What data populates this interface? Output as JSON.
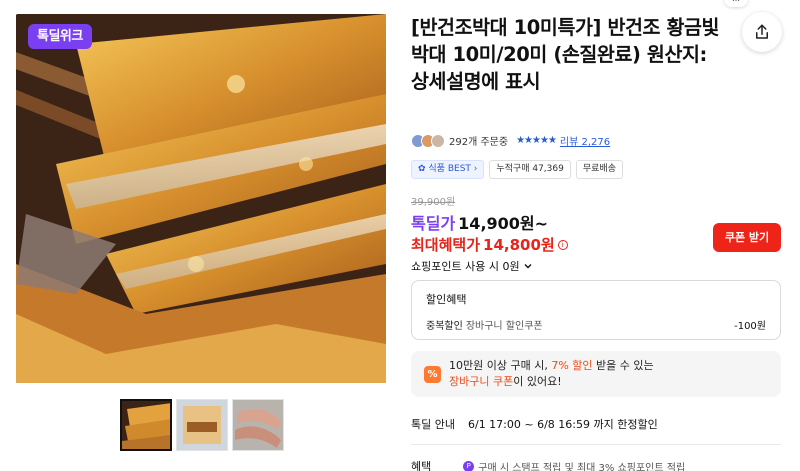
{
  "main_image": {
    "badge": "톡딜위크",
    "alt": "main-product-photo"
  },
  "thumbnails": [
    {
      "alt": "thumb-1"
    },
    {
      "alt": "thumb-2"
    },
    {
      "alt": "thumb-3"
    }
  ],
  "product": {
    "title": "[반건조박대 10미특가] 반건조 황금빛 박대 10미/20미 (손질완료) 원산지: 상세설명에 표시"
  },
  "share": {
    "tooltip": "…"
  },
  "stats": {
    "orders": "292개 주문중",
    "stars": "★★★★★",
    "review": "리뷰 2,276"
  },
  "tags": [
    "식품 BEST",
    "누적구매 47,369",
    "무료배송"
  ],
  "price": {
    "original": "39,900원",
    "deal_label": "톡딜가",
    "deal_price": "14,900원~",
    "max_label": "최대혜택가",
    "max_price": "14,800원",
    "coupon_button": "쿠폰 받기",
    "point_text": "쇼핑포인트 사용 시 0원"
  },
  "benefit": {
    "title": "할인혜택",
    "row_key": "중복할인",
    "row_desc": "장바구니 할인쿠폰",
    "row_amount": "-100원"
  },
  "promo": {
    "icon": "%",
    "line1_a": "10만원 이상 구매 시, ",
    "line1_accent": "7% 할인",
    "line1_b": " 받을 수 있는",
    "line2_accent": "장바구니 쿠폰",
    "line2_b": "이 있어요!"
  },
  "notice": {
    "label": "톡딜 안내",
    "text": "6/1 17:00 ~ 6/8 16:59 까지 한정할인"
  },
  "perks": {
    "label": "혜택",
    "text": "구매 시 스탬프 적립 및 최대 3% 쇼핑포인트 적립"
  },
  "colors": {
    "deal_purple": "#7b3ff2",
    "price_red": "#e8231a",
    "coupon_red": "#ef2418",
    "link_blue": "#2a5bd7",
    "promo_orange": "#ef4d17"
  }
}
